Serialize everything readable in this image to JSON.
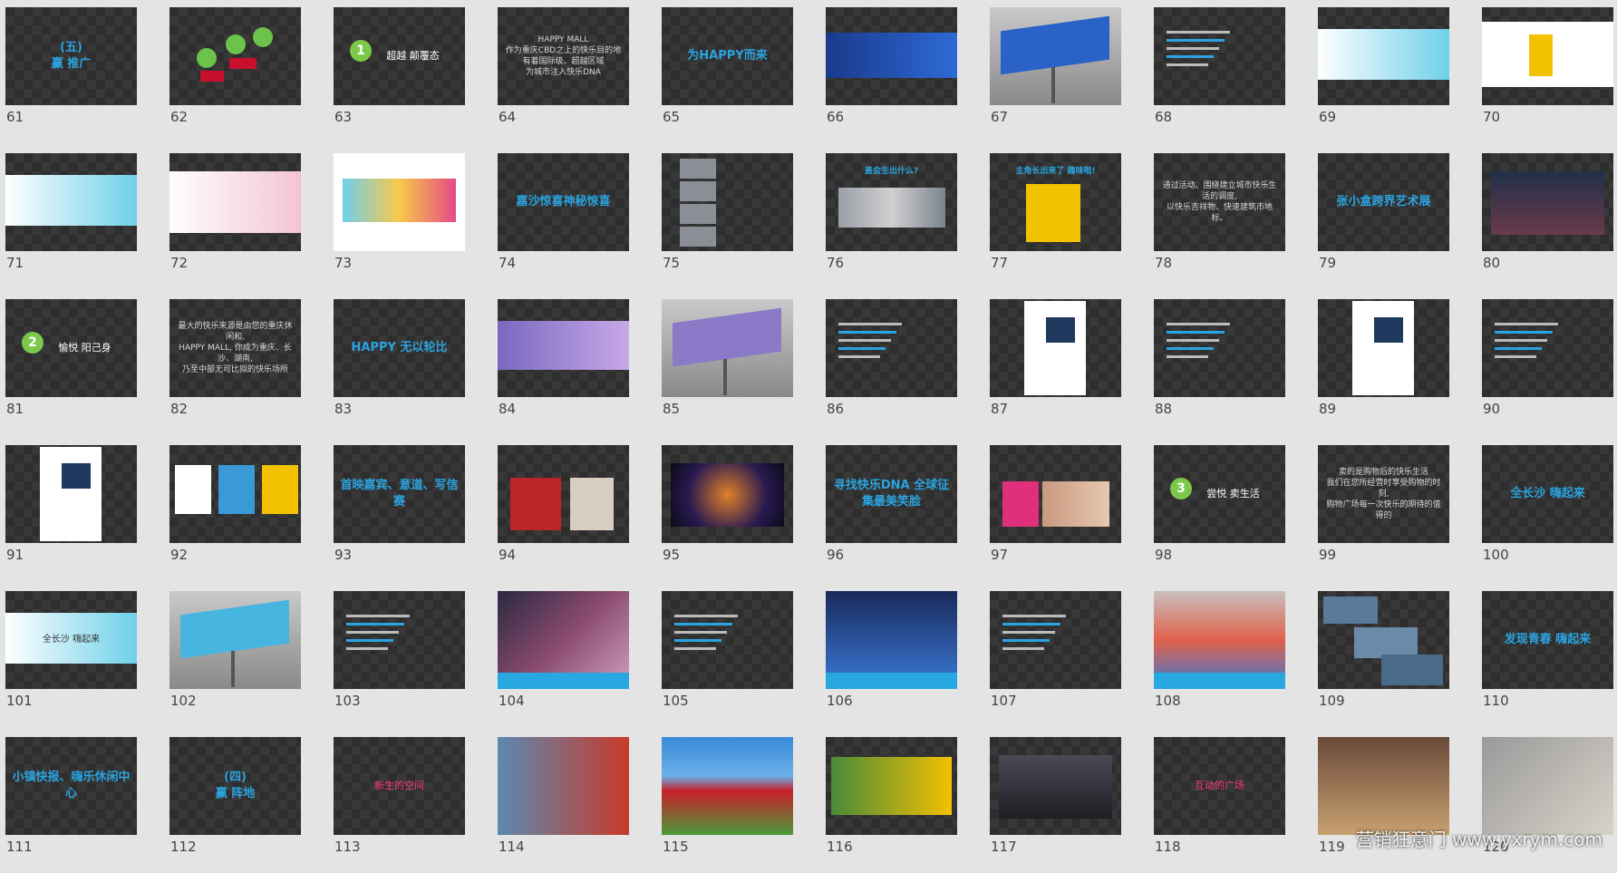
{
  "slides": [
    {
      "number": "61",
      "text": "(五)\n赢 推广",
      "style": "title"
    },
    {
      "number": "62",
      "text": "",
      "style": "dots"
    },
    {
      "number": "63",
      "text": "超越 颠覆态",
      "style": "badge",
      "badge": "1"
    },
    {
      "number": "64",
      "text": "HAPPY MALL\n作为重庆CBD之上的快乐目的地\n有着国际级、超越区域\n为城市注入快乐DNA",
      "style": "plain"
    },
    {
      "number": "65",
      "text": "为HAPPY而来",
      "style": "title"
    },
    {
      "number": "66",
      "text": "",
      "style": "bluebanner"
    },
    {
      "number": "67",
      "text": "",
      "style": "billboard"
    },
    {
      "number": "68",
      "text": "",
      "style": "smalltext"
    },
    {
      "number": "69",
      "text": "",
      "style": "whitebanner"
    },
    {
      "number": "70",
      "text": "",
      "style": "whiteyellow"
    },
    {
      "number": "71",
      "text": "",
      "style": "whitebanner"
    },
    {
      "number": "72",
      "text": "",
      "style": "whitepink"
    },
    {
      "number": "73",
      "text": "",
      "style": "whiteplan"
    },
    {
      "number": "74",
      "text": "嘉沙惊喜神秘惊喜",
      "style": "title"
    },
    {
      "number": "75",
      "text": "",
      "style": "photostack"
    },
    {
      "number": "76",
      "text": "盖会生出什么?",
      "style": "photostrip"
    },
    {
      "number": "77",
      "text": "主角长出来了 趣味啦!",
      "style": "yellowchar"
    },
    {
      "number": "78",
      "text": "通过活动、围绕建立城市快乐生活的调度,\n以快乐吉祥物、快速建筑市地标。",
      "style": "plain"
    },
    {
      "number": "79",
      "text": "张小盒跨界艺术展",
      "style": "title"
    },
    {
      "number": "80",
      "text": "",
      "style": "crowd"
    },
    {
      "number": "81",
      "text": "愉悦 阳己身",
      "style": "badge",
      "badge": "2"
    },
    {
      "number": "82",
      "text": "最大的快乐来源是由您的重庆休闲和,\nHAPPY MALL, 你成为重庆、长沙、湖南,\n乃至中部无可比拟的快乐场所",
      "style": "plain"
    },
    {
      "number": "83",
      "text": "HAPPY 无以轮比",
      "style": "title"
    },
    {
      "number": "84",
      "text": "",
      "style": "purplebanner"
    },
    {
      "number": "85",
      "text": "",
      "style": "purplebillboard"
    },
    {
      "number": "86",
      "text": "",
      "style": "smalltext"
    },
    {
      "number": "87",
      "text": "",
      "style": "whitepage"
    },
    {
      "number": "88",
      "text": "",
      "style": "smalltext"
    },
    {
      "number": "89",
      "text": "",
      "style": "whitepage"
    },
    {
      "number": "90",
      "text": "",
      "style": "smalltext"
    },
    {
      "number": "91",
      "text": "",
      "style": "whitepage"
    },
    {
      "number": "92",
      "text": "",
      "style": "threeposters"
    },
    {
      "number": "93",
      "text": "首映嘉宾、意道、写信赛",
      "style": "title"
    },
    {
      "number": "94",
      "text": "",
      "style": "mailbox"
    },
    {
      "number": "95",
      "text": "",
      "style": "fireworks"
    },
    {
      "number": "96",
      "text": "寻找快乐DNA 全球征集最美笑脸",
      "style": "title"
    },
    {
      "number": "97",
      "text": "",
      "style": "faces"
    },
    {
      "number": "98",
      "text": "尝悦 卖生活",
      "style": "badge",
      "badge": "3"
    },
    {
      "number": "99",
      "text": "卖的是购物后的快乐生活\n我们在您所经营时享受购物的时刻,\n购物广场每一次快乐的期待的值得的",
      "style": "plain"
    },
    {
      "number": "100",
      "text": "全长沙 嗨起来",
      "style": "title"
    },
    {
      "number": "101",
      "text": "全长沙   嗨起来",
      "style": "whitebanner2"
    },
    {
      "number": "102",
      "text": "",
      "style": "bluebillboard"
    },
    {
      "number": "103",
      "text": "",
      "style": "smalltext"
    },
    {
      "number": "104",
      "text": "",
      "style": "fashion1"
    },
    {
      "number": "105",
      "text": "",
      "style": "smalltext"
    },
    {
      "number": "106",
      "text": "",
      "style": "fashion2"
    },
    {
      "number": "107",
      "text": "",
      "style": "smalltext"
    },
    {
      "number": "108",
      "text": "",
      "style": "fashion3"
    },
    {
      "number": "109",
      "text": "",
      "style": "collage"
    },
    {
      "number": "110",
      "text": "发现青春 嗨起来",
      "style": "title"
    },
    {
      "number": "111",
      "text": "小镇快报、嗨乐休闲中心",
      "style": "title"
    },
    {
      "number": "112",
      "text": "(四)\n赢 阵地",
      "style": "title"
    },
    {
      "number": "113",
      "text": "新生的空间",
      "style": "pink"
    },
    {
      "number": "114",
      "text": "",
      "style": "sculpture1"
    },
    {
      "number": "115",
      "text": "",
      "style": "tulips"
    },
    {
      "number": "116",
      "text": "",
      "style": "bears"
    },
    {
      "number": "117",
      "text": "",
      "style": "street"
    },
    {
      "number": "118",
      "text": "互动的广场",
      "style": "pink"
    },
    {
      "number": "119",
      "text": "",
      "style": "bench"
    },
    {
      "number": "120",
      "text": "",
      "style": "stone"
    }
  ],
  "watermark": "营销狂意门 www.yxrym.com"
}
